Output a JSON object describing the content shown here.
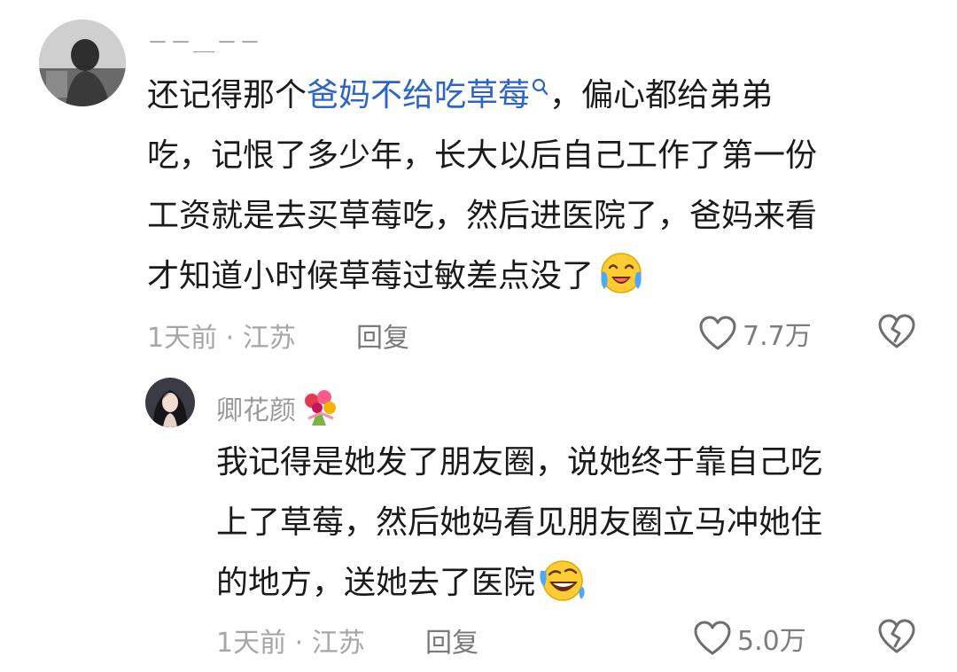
{
  "comments": [
    {
      "username": "－－＿－－",
      "text_prefix": "还记得那个",
      "link_text": "爸妈不给吃草莓",
      "line1_rest": "，偏心都给弟弟",
      "line2": "吃，记恨了多少年，长大以后自己工作了第一份",
      "line3": "工资就是去买草莓吃，然后进医院了，爸妈来看",
      "line4": "才知道小时候草莓过敏差点没了",
      "emoji_icon": "tears-of-joy-emoji",
      "meta": "1天前 · 江苏",
      "reply_label": "回复",
      "likes": "7.7万"
    },
    {
      "username": "卿花颜",
      "username_icon": "bouquet-emoji",
      "line1": "我记得是她发了朋友圈，说她终于靠自己吃",
      "line2": "上了草莓，然后她妈看见朋友圈立马冲她住",
      "line3": "的地方，送她去了医院",
      "emoji_icon": "rolling-laughing-emoji",
      "meta": "1天前 · 江苏",
      "reply_label": "回复",
      "likes": "5.0万"
    }
  ],
  "colors": {
    "link": "#2c64c9",
    "meta": "#a6a6a6",
    "text": "#1a1a1a"
  }
}
